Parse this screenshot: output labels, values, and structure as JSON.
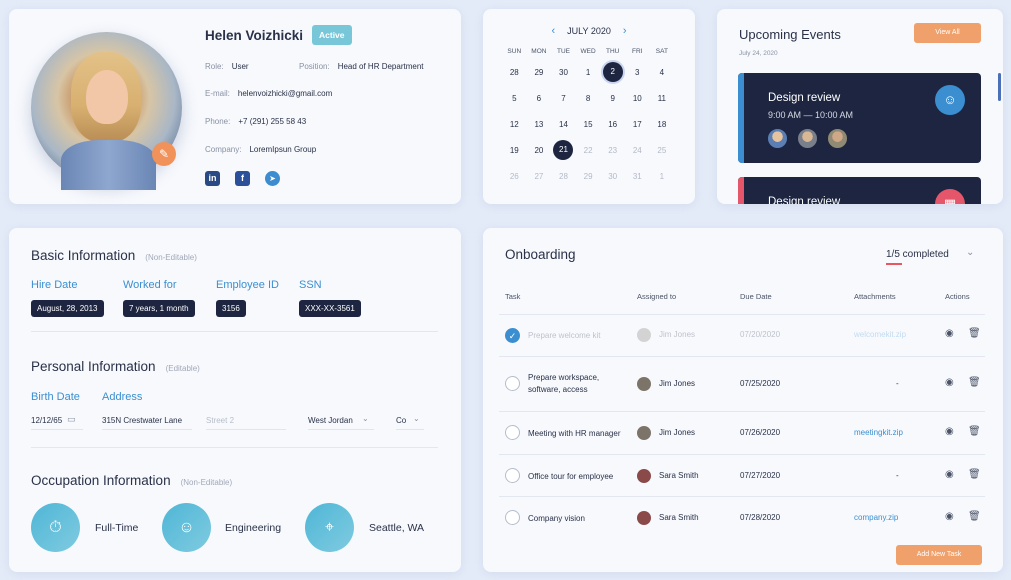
{
  "profile": {
    "name": "Helen Voizhicki",
    "status": "Active",
    "role_label": "Role:",
    "role": "User",
    "position_label": "Position:",
    "position": "Head of HR Department",
    "email_label": "E-mail:",
    "email": "helenvoizhicki@gmail.com",
    "phone_label": "Phone:",
    "phone": "+7 (291) 255 58 43",
    "company_label": "Company:",
    "company": "LoremIpsun Group",
    "social": [
      "linkedin-icon",
      "facebook-icon",
      "telegram-icon"
    ]
  },
  "calendar": {
    "month": "JULY 2020",
    "weekdays": [
      "SUN",
      "MON",
      "TUE",
      "WED",
      "THU",
      "FRI",
      "SAT"
    ],
    "weeks": [
      [
        "28",
        "29",
        "30",
        "1",
        "2",
        "3",
        "4"
      ],
      [
        "5",
        "6",
        "7",
        "8",
        "9",
        "10",
        "11"
      ],
      [
        "12",
        "13",
        "14",
        "15",
        "16",
        "17",
        "18"
      ],
      [
        "19",
        "20",
        "21",
        "22",
        "23",
        "24",
        "25"
      ],
      [
        "26",
        "27",
        "28",
        "29",
        "30",
        "31",
        "1"
      ]
    ]
  },
  "events": {
    "title": "Upcoming Events",
    "date": "July 24, 2020",
    "view_all": "View All",
    "items": [
      {
        "name": "Design review",
        "time": "9:00 AM — 10:00 AM"
      },
      {
        "name": "Design review"
      }
    ]
  },
  "basic": {
    "title": "Basic Information",
    "note": "(Non-Editable)",
    "fields": [
      {
        "label": "Hire Date",
        "value": "August, 28, 2013"
      },
      {
        "label": "Worked for",
        "value": "7 years, 1 month"
      },
      {
        "label": "Employee ID",
        "value": "3156"
      },
      {
        "label": "SSN",
        "value": "XXX-XX-3561"
      }
    ]
  },
  "personal": {
    "title": "Personal Information",
    "note": "(Editable)",
    "birth_label": "Birth Date",
    "birth": "12/12/65",
    "address_label": "Address",
    "address": "315N Crestwater Lane",
    "street2_placeholder": "Street 2",
    "city": "West Jordan",
    "country": "Co"
  },
  "occupation": {
    "title": "Occupation Information",
    "note": "(Non-Editable)",
    "items": [
      "Full-Time",
      "Engineering",
      "Seattle, WA"
    ]
  },
  "onboarding": {
    "title": "Onboarding",
    "completed": "1/5 completed",
    "headers": [
      "Task",
      "Assigned to",
      "Due Date",
      "Attachments",
      "Actions"
    ],
    "rows": [
      {
        "task": "Prepare welcome kit",
        "person": "Jim Jones",
        "date": "07/20/2020",
        "attachment": "welcomekit.zip",
        "done": true
      },
      {
        "task": "Prepare workspace, software, access",
        "person": "Jim Jones",
        "date": "07/25/2020",
        "attachment": "-",
        "done": false
      },
      {
        "task": "Meeting with HR manager",
        "person": "Jim Jones",
        "date": "07/26/2020",
        "attachment": "meetingkit.zip",
        "done": false
      },
      {
        "task": "Office tour for employee",
        "person": "Sara Smith",
        "date": "07/27/2020",
        "attachment": "-",
        "done": false
      },
      {
        "task": "Company vision",
        "person": "Sara Smith",
        "date": "07/28/2020",
        "attachment": "company.zip",
        "done": false
      }
    ],
    "add_task": "Add New Task"
  }
}
